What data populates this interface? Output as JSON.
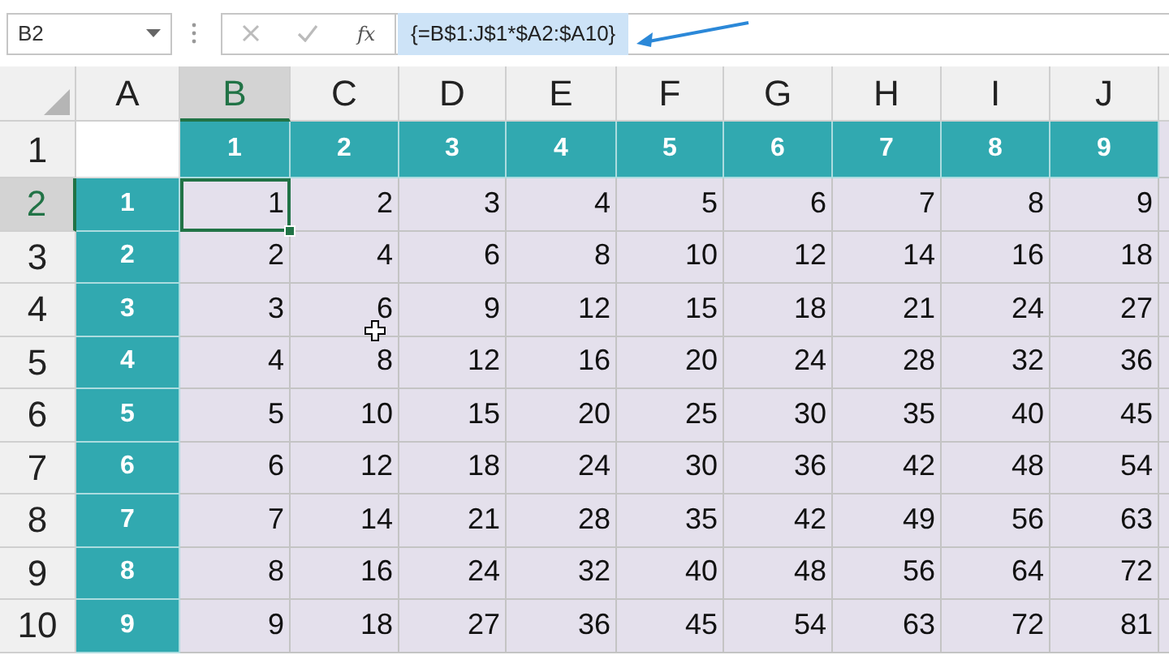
{
  "name_box": {
    "value": "B2"
  },
  "formula_bar": {
    "function_button": "fx",
    "formula": "{=B$1:J$1*$A2:$A10}",
    "selected": true
  },
  "column_headers": [
    {
      "label": "A",
      "selected": false
    },
    {
      "label": "B",
      "selected": true
    },
    {
      "label": "C",
      "selected": false
    },
    {
      "label": "D",
      "selected": false
    },
    {
      "label": "E",
      "selected": false
    },
    {
      "label": "F",
      "selected": false
    },
    {
      "label": "G",
      "selected": false
    },
    {
      "label": "H",
      "selected": false
    },
    {
      "label": "I",
      "selected": false
    },
    {
      "label": "J",
      "selected": false
    }
  ],
  "rows": [
    {
      "header": "1",
      "selected": false,
      "cells": [
        {
          "kind": "blank",
          "selected": false
        },
        {
          "kind": "header",
          "value": "1",
          "selected": false
        },
        {
          "kind": "header",
          "value": "2",
          "selected": false
        },
        {
          "kind": "header",
          "value": "3",
          "selected": false
        },
        {
          "kind": "header",
          "value": "4",
          "selected": false
        },
        {
          "kind": "header",
          "value": "5",
          "selected": false
        },
        {
          "kind": "header",
          "value": "6",
          "selected": false
        },
        {
          "kind": "header",
          "value": "7",
          "selected": false
        },
        {
          "kind": "header",
          "value": "8",
          "selected": false
        },
        {
          "kind": "header",
          "value": "9",
          "selected": false
        }
      ]
    },
    {
      "header": "2",
      "selected": true,
      "cells": [
        {
          "kind": "header",
          "value": "1",
          "selected": false
        },
        {
          "kind": "value",
          "value": "1",
          "selected": true
        },
        {
          "kind": "value",
          "value": "2",
          "selected": false
        },
        {
          "kind": "value",
          "value": "3",
          "selected": false
        },
        {
          "kind": "value",
          "value": "4",
          "selected": false
        },
        {
          "kind": "value",
          "value": "5",
          "selected": false
        },
        {
          "kind": "value",
          "value": "6",
          "selected": false
        },
        {
          "kind": "value",
          "value": "7",
          "selected": false
        },
        {
          "kind": "value",
          "value": "8",
          "selected": false
        },
        {
          "kind": "value",
          "value": "9",
          "selected": false
        }
      ]
    },
    {
      "header": "3",
      "selected": false,
      "cells": [
        {
          "kind": "header",
          "value": "2",
          "selected": false
        },
        {
          "kind": "value",
          "value": "2",
          "selected": false
        },
        {
          "kind": "value",
          "value": "4",
          "selected": false
        },
        {
          "kind": "value",
          "value": "6",
          "selected": false
        },
        {
          "kind": "value",
          "value": "8",
          "selected": false
        },
        {
          "kind": "value",
          "value": "10",
          "selected": false
        },
        {
          "kind": "value",
          "value": "12",
          "selected": false
        },
        {
          "kind": "value",
          "value": "14",
          "selected": false
        },
        {
          "kind": "value",
          "value": "16",
          "selected": false
        },
        {
          "kind": "value",
          "value": "18",
          "selected": false
        }
      ]
    },
    {
      "header": "4",
      "selected": false,
      "cells": [
        {
          "kind": "header",
          "value": "3",
          "selected": false
        },
        {
          "kind": "value",
          "value": "3",
          "selected": false
        },
        {
          "kind": "value",
          "value": "6",
          "selected": false
        },
        {
          "kind": "value",
          "value": "9",
          "selected": false
        },
        {
          "kind": "value",
          "value": "12",
          "selected": false
        },
        {
          "kind": "value",
          "value": "15",
          "selected": false
        },
        {
          "kind": "value",
          "value": "18",
          "selected": false
        },
        {
          "kind": "value",
          "value": "21",
          "selected": false
        },
        {
          "kind": "value",
          "value": "24",
          "selected": false
        },
        {
          "kind": "value",
          "value": "27",
          "selected": false
        }
      ]
    },
    {
      "header": "5",
      "selected": false,
      "cells": [
        {
          "kind": "header",
          "value": "4",
          "selected": false
        },
        {
          "kind": "value",
          "value": "4",
          "selected": false
        },
        {
          "kind": "value",
          "value": "8",
          "selected": false
        },
        {
          "kind": "value",
          "value": "12",
          "selected": false
        },
        {
          "kind": "value",
          "value": "16",
          "selected": false
        },
        {
          "kind": "value",
          "value": "20",
          "selected": false
        },
        {
          "kind": "value",
          "value": "24",
          "selected": false
        },
        {
          "kind": "value",
          "value": "28",
          "selected": false
        },
        {
          "kind": "value",
          "value": "32",
          "selected": false
        },
        {
          "kind": "value",
          "value": "36",
          "selected": false
        }
      ]
    },
    {
      "header": "6",
      "selected": false,
      "cells": [
        {
          "kind": "header",
          "value": "5",
          "selected": false
        },
        {
          "kind": "value",
          "value": "5",
          "selected": false
        },
        {
          "kind": "value",
          "value": "10",
          "selected": false
        },
        {
          "kind": "value",
          "value": "15",
          "selected": false
        },
        {
          "kind": "value",
          "value": "20",
          "selected": false
        },
        {
          "kind": "value",
          "value": "25",
          "selected": false
        },
        {
          "kind": "value",
          "value": "30",
          "selected": false
        },
        {
          "kind": "value",
          "value": "35",
          "selected": false
        },
        {
          "kind": "value",
          "value": "40",
          "selected": false
        },
        {
          "kind": "value",
          "value": "45",
          "selected": false
        }
      ]
    },
    {
      "header": "7",
      "selected": false,
      "cells": [
        {
          "kind": "header",
          "value": "6",
          "selected": false
        },
        {
          "kind": "value",
          "value": "6",
          "selected": false
        },
        {
          "kind": "value",
          "value": "12",
          "selected": false
        },
        {
          "kind": "value",
          "value": "18",
          "selected": false
        },
        {
          "kind": "value",
          "value": "24",
          "selected": false
        },
        {
          "kind": "value",
          "value": "30",
          "selected": false
        },
        {
          "kind": "value",
          "value": "36",
          "selected": false
        },
        {
          "kind": "value",
          "value": "42",
          "selected": false
        },
        {
          "kind": "value",
          "value": "48",
          "selected": false
        },
        {
          "kind": "value",
          "value": "54",
          "selected": false
        }
      ]
    },
    {
      "header": "8",
      "selected": false,
      "cells": [
        {
          "kind": "header",
          "value": "7",
          "selected": false
        },
        {
          "kind": "value",
          "value": "7",
          "selected": false
        },
        {
          "kind": "value",
          "value": "14",
          "selected": false
        },
        {
          "kind": "value",
          "value": "21",
          "selected": false
        },
        {
          "kind": "value",
          "value": "28",
          "selected": false
        },
        {
          "kind": "value",
          "value": "35",
          "selected": false
        },
        {
          "kind": "value",
          "value": "42",
          "selected": false
        },
        {
          "kind": "value",
          "value": "49",
          "selected": false
        },
        {
          "kind": "value",
          "value": "56",
          "selected": false
        },
        {
          "kind": "value",
          "value": "63",
          "selected": false
        }
      ]
    },
    {
      "header": "9",
      "selected": false,
      "cells": [
        {
          "kind": "header",
          "value": "8",
          "selected": false
        },
        {
          "kind": "value",
          "value": "8",
          "selected": false
        },
        {
          "kind": "value",
          "value": "16",
          "selected": false
        },
        {
          "kind": "value",
          "value": "24",
          "selected": false
        },
        {
          "kind": "value",
          "value": "32",
          "selected": false
        },
        {
          "kind": "value",
          "value": "40",
          "selected": false
        },
        {
          "kind": "value",
          "value": "48",
          "selected": false
        },
        {
          "kind": "value",
          "value": "56",
          "selected": false
        },
        {
          "kind": "value",
          "value": "64",
          "selected": false
        },
        {
          "kind": "value",
          "value": "72",
          "selected": false
        }
      ]
    },
    {
      "header": "10",
      "selected": false,
      "cells": [
        {
          "kind": "header",
          "value": "9",
          "selected": false
        },
        {
          "kind": "value",
          "value": "9",
          "selected": false
        },
        {
          "kind": "value",
          "value": "18",
          "selected": false
        },
        {
          "kind": "value",
          "value": "27",
          "selected": false
        },
        {
          "kind": "value",
          "value": "36",
          "selected": false
        },
        {
          "kind": "value",
          "value": "45",
          "selected": false
        },
        {
          "kind": "value",
          "value": "54",
          "selected": false
        },
        {
          "kind": "value",
          "value": "63",
          "selected": false
        },
        {
          "kind": "value",
          "value": "72",
          "selected": false
        },
        {
          "kind": "value",
          "value": "81",
          "selected": false
        }
      ]
    }
  ]
}
